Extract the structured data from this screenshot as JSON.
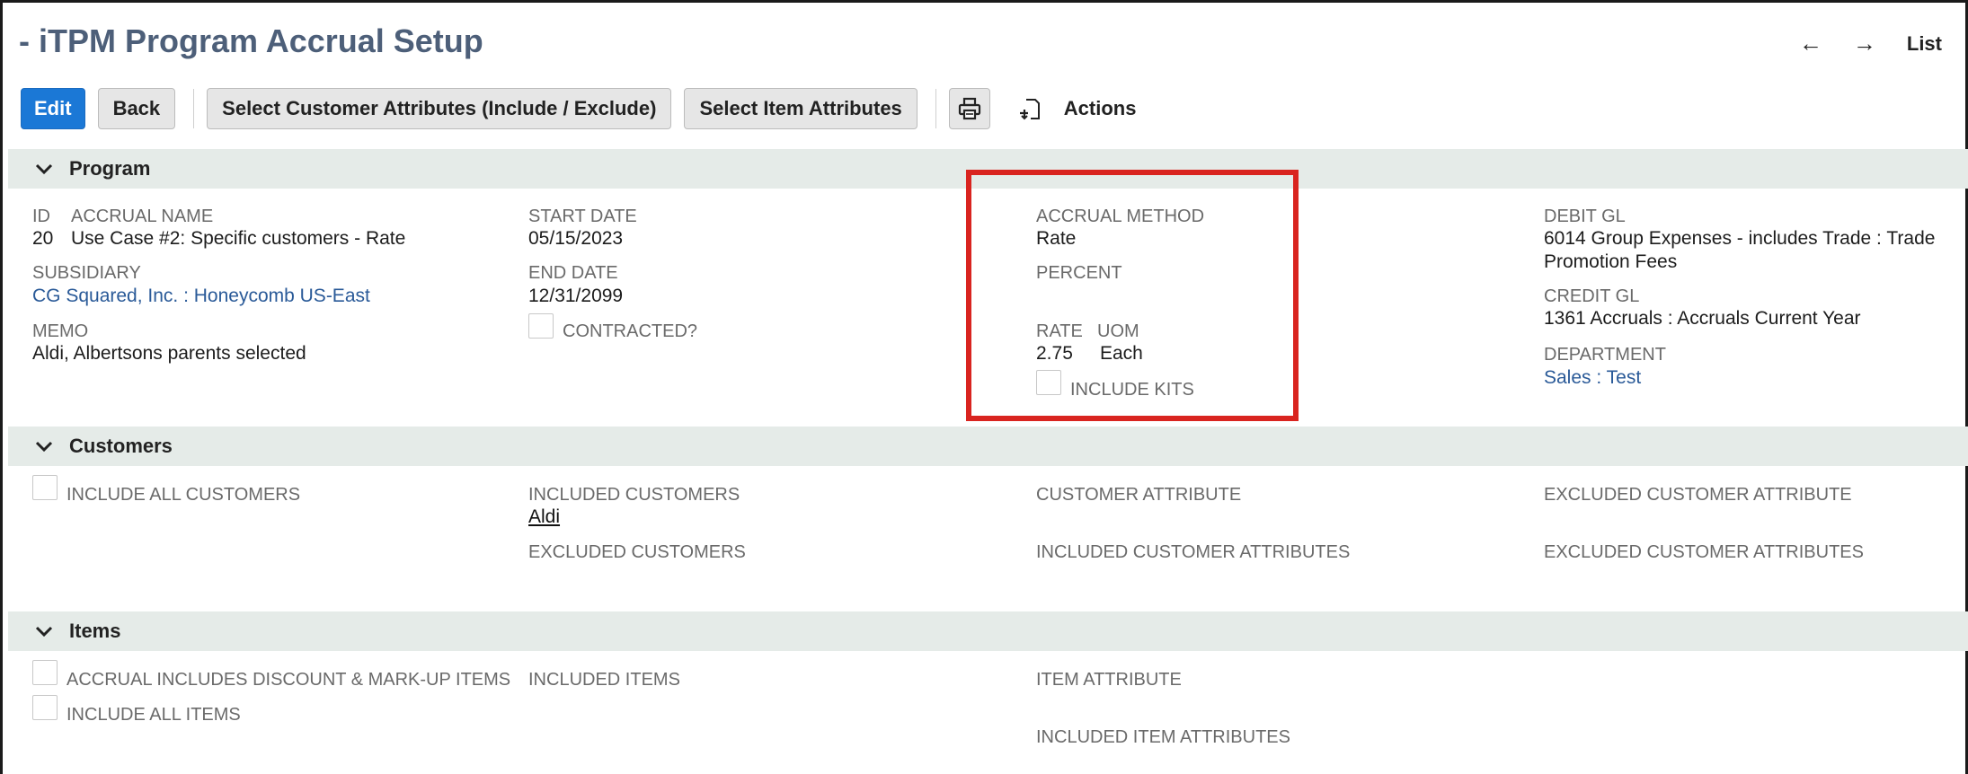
{
  "header": {
    "title": "- iTPM Program Accrual Setup",
    "nav_prev": "←",
    "nav_next": "→",
    "nav_list": "List"
  },
  "toolbar": {
    "edit": "Edit",
    "back": "Back",
    "select_customer_attributes": "Select Customer Attributes (Include / Exclude)",
    "select_item_attributes": "Select Item Attributes",
    "print_icon": "printer-icon",
    "export_icon": "download-icon",
    "actions": "Actions"
  },
  "program": {
    "section_title": "Program",
    "id_label": "ID",
    "id_value": "20",
    "accrual_name_label": "ACCRUAL NAME",
    "accrual_name_value": "Use Case #2: Specific customers - Rate",
    "subsidiary_label": "SUBSIDIARY",
    "subsidiary_value": "CG Squared, Inc. : Honeycomb US-East",
    "memo_label": "MEMO",
    "memo_value": "Aldi, Albertsons parents selected",
    "start_date_label": "START DATE",
    "start_date_value": "05/15/2023",
    "end_date_label": "END DATE",
    "end_date_value": "12/31/2099",
    "contracted_label": "CONTRACTED?",
    "accrual_method_label": "ACCRUAL METHOD",
    "accrual_method_value": "Rate",
    "percent_label": "PERCENT",
    "rate_label": "RATE",
    "rate_value": "2.75",
    "uom_label": "UOM",
    "uom_value": "Each",
    "include_kits_label": "INCLUDE KITS",
    "debit_gl_label": "DEBIT GL",
    "debit_gl_line1": "6014 Group Expenses - includes Trade : Trade",
    "debit_gl_line2": "Promotion Fees",
    "credit_gl_label": "CREDIT GL",
    "credit_gl_value": "1361 Accruals : Accruals Current Year",
    "department_label": "DEPARTMENT",
    "department_value": "Sales : Test"
  },
  "customers": {
    "section_title": "Customers",
    "include_all_label": "INCLUDE ALL CUSTOMERS",
    "included_customers_label": "INCLUDED CUSTOMERS",
    "included_customers_value": "Aldi",
    "excluded_customers_label": "EXCLUDED CUSTOMERS",
    "customer_attribute_label": "CUSTOMER ATTRIBUTE",
    "included_customer_attributes_label": "INCLUDED CUSTOMER ATTRIBUTES",
    "excluded_customer_attribute_label": "EXCLUDED CUSTOMER ATTRIBUTE",
    "excluded_customer_attributes_label": "EXCLUDED CUSTOMER ATTRIBUTES"
  },
  "items": {
    "section_title": "Items",
    "accrual_includes_discount_label": "ACCRUAL INCLUDES DISCOUNT & MARK-UP ITEMS",
    "include_all_items_label": "INCLUDE ALL ITEMS",
    "included_items_label": "INCLUDED ITEMS",
    "item_attribute_label": "ITEM ATTRIBUTE",
    "included_item_attributes_label": "INCLUDED ITEM ATTRIBUTES"
  },
  "colors": {
    "title": "#4d5f79",
    "primary_button": "#1b78d6",
    "section_bar": "#e5ebe8",
    "link": "#2a5a98",
    "highlight": "#d9241f"
  }
}
